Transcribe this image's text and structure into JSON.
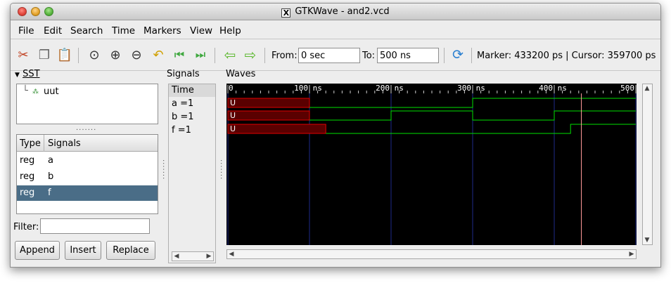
{
  "window": {
    "title": "GTKWave - and2.vcd"
  },
  "menu": [
    "File",
    "Edit",
    "Search",
    "Time",
    "Markers",
    "View",
    "Help"
  ],
  "toolbar": {
    "from_label": "From:",
    "from_value": "0 sec",
    "to_label": "To:",
    "to_value": "500 ns",
    "status": "Marker: 433200 ps  |  Cursor: 359700 ps",
    "icons": [
      "cut-icon",
      "copy-icon",
      "paste-icon",
      "zoom-fit-icon",
      "zoom-in-icon",
      "zoom-out-icon",
      "undo-icon",
      "go-start-icon",
      "go-end-icon",
      "arrow-left-icon",
      "arrow-right-icon",
      "reload-icon"
    ]
  },
  "sst": {
    "title": "SST",
    "tree": [
      "uut"
    ],
    "columns": [
      "Type",
      "Signals"
    ],
    "rows": [
      {
        "type": "reg",
        "name": "a"
      },
      {
        "type": "reg",
        "name": "b"
      },
      {
        "type": "reg",
        "name": "f"
      }
    ],
    "selected_index": 2,
    "filter_label": "Filter:",
    "filter_value": "",
    "buttons": [
      "Append",
      "Insert",
      "Replace"
    ]
  },
  "signals_panel": {
    "title": "Signals",
    "header": "Time",
    "names": [
      "a =1",
      "b =1",
      "f =1"
    ]
  },
  "waves_panel": {
    "title": "Waves",
    "axis_labels": [
      "0",
      "100 ns",
      "200 ns",
      "300 ns",
      "400 ns",
      "500"
    ],
    "undefined_label": "U",
    "colors": {
      "background": "#000000",
      "trace": "#00e000",
      "undefined": "#e00000",
      "marker": "#ff9a9a",
      "grid": "#1e2a8a"
    }
  },
  "chart_data": {
    "type": "line",
    "x_units": "ns",
    "xlim": [
      0,
      500
    ],
    "ticks": [
      0,
      100,
      200,
      300,
      400,
      500
    ],
    "series": [
      {
        "name": "a",
        "undefined_until": 100,
        "edges": [
          {
            "t": 100,
            "v": 0
          },
          {
            "t": 300,
            "v": 1
          }
        ]
      },
      {
        "name": "b",
        "undefined_until": 100,
        "edges": [
          {
            "t": 100,
            "v": 0
          },
          {
            "t": 200,
            "v": 1
          },
          {
            "t": 300,
            "v": 0
          },
          {
            "t": 400,
            "v": 1
          }
        ]
      },
      {
        "name": "f",
        "undefined_until": 120,
        "edges": [
          {
            "t": 120,
            "v": 0
          },
          {
            "t": 420,
            "v": 1
          }
        ]
      }
    ],
    "cursor_ns": 433.2
  }
}
